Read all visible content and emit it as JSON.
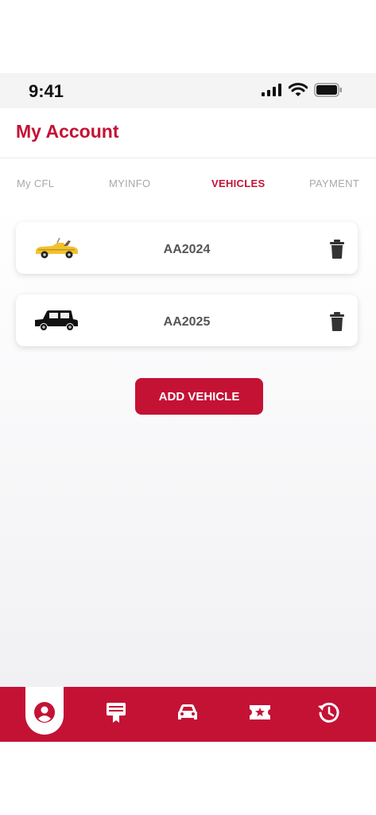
{
  "status_bar": {
    "time": "9:41"
  },
  "header": {
    "title": "My Account"
  },
  "tabs": [
    {
      "label": "My CFL",
      "active": false
    },
    {
      "label": "MYINFO",
      "active": false
    },
    {
      "label": "VEHICLES",
      "active": true
    },
    {
      "label": "PAYMENT",
      "active": false
    }
  ],
  "vehicles": [
    {
      "plate": "AA2024",
      "icon": "yellow-convertible-car-icon",
      "color": "#f2c12e"
    },
    {
      "plate": "AA2025",
      "icon": "black-suv-car-icon",
      "color": "#111111"
    }
  ],
  "actions": {
    "add_vehicle_label": "ADD VEHICLE"
  },
  "bottom_nav": [
    {
      "icon": "account-icon",
      "active": true
    },
    {
      "icon": "tickets-icon",
      "active": false
    },
    {
      "icon": "car-icon",
      "active": false
    },
    {
      "icon": "favorites-icon",
      "active": false
    },
    {
      "icon": "history-icon",
      "active": false
    }
  ],
  "colors": {
    "brand": "#c41235",
    "inactive_tab": "#a8a8a8"
  }
}
